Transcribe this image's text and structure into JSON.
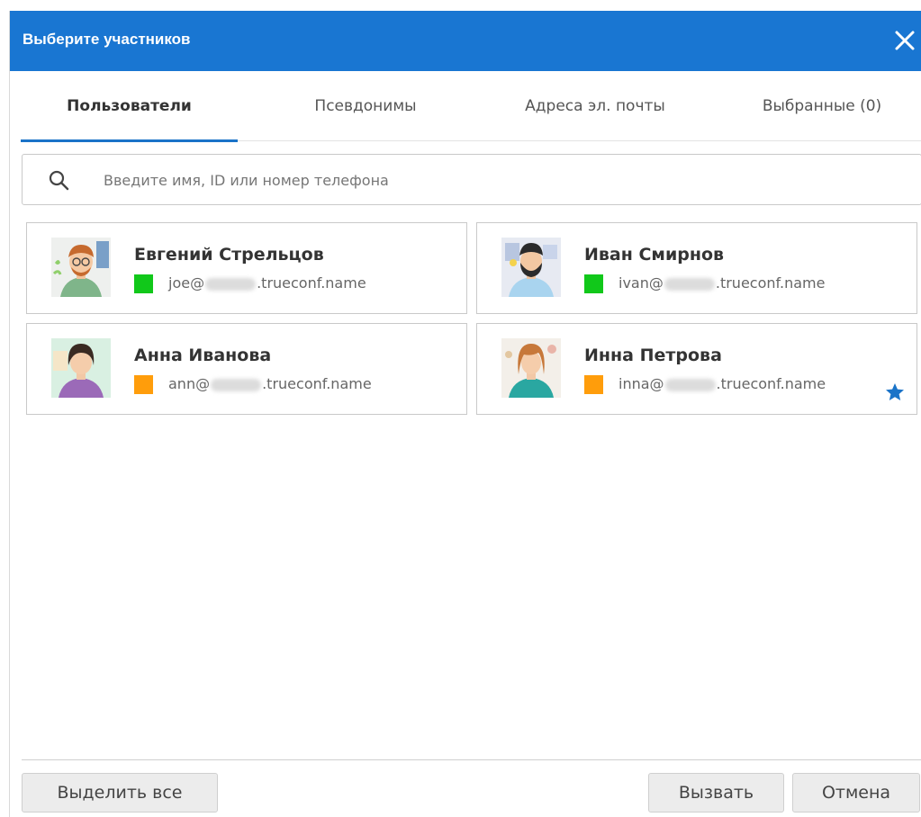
{
  "dialog": {
    "title": "Выберите участников"
  },
  "tabs": [
    {
      "label": "Пользователи",
      "active": true
    },
    {
      "label": "Псевдонимы",
      "active": false
    },
    {
      "label": "Адреса эл. почты",
      "active": false
    },
    {
      "label": "Выбранные (0)",
      "active": false
    }
  ],
  "search": {
    "placeholder": "Введите имя, ID или номер телефона",
    "value": ""
  },
  "users": [
    {
      "name": "Евгений Стрельцов",
      "email_prefix": "joe@",
      "email_suffix": ".trueconf.name",
      "status_color": "#11c81a",
      "favorite": false
    },
    {
      "name": "Иван Смирнов",
      "email_prefix": "ivan@",
      "email_suffix": ".trueconf.name",
      "status_color": "#11c81a",
      "favorite": false
    },
    {
      "name": "Анна Иванова",
      "email_prefix": "ann@",
      "email_suffix": ".trueconf.name",
      "status_color": "#ff9d0b",
      "favorite": false
    },
    {
      "name": "Инна Петрова",
      "email_prefix": "inna@",
      "email_suffix": ".trueconf.name",
      "status_color": "#ff9d0b",
      "favorite": true
    }
  ],
  "footer": {
    "select_all_label": "Выделить все",
    "call_label": "Вызвать",
    "cancel_label": "Отмена"
  },
  "colors": {
    "header": "#1976d2",
    "accent": "#1a73c8",
    "online": "#11c81a",
    "away": "#ff9d0b"
  }
}
